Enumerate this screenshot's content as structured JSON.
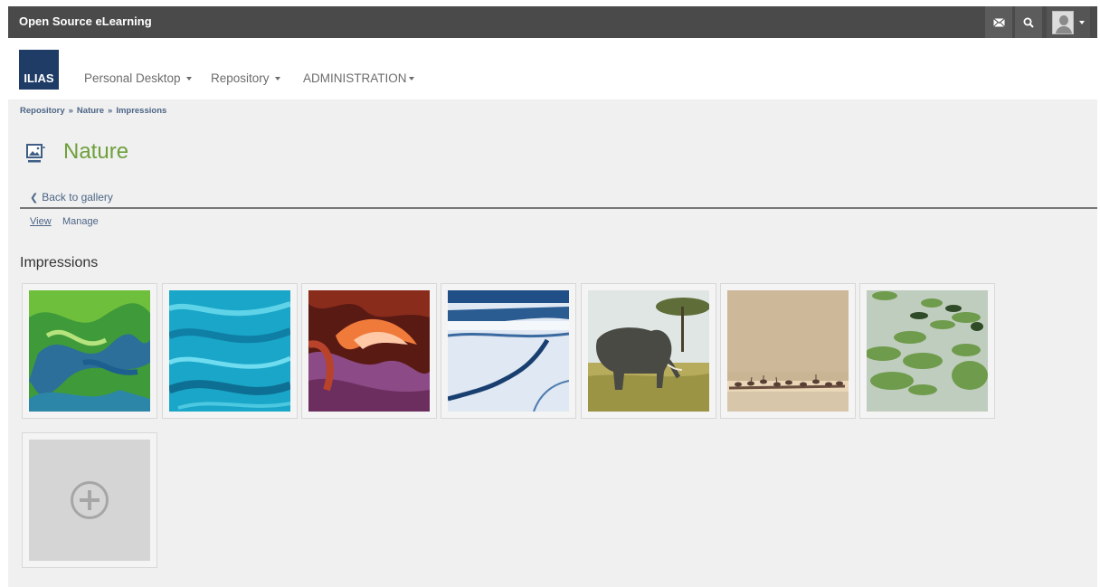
{
  "topbar": {
    "brand": "Open Source eLearning",
    "icons": [
      "mail-icon",
      "search-icon",
      "user-avatar-icon"
    ]
  },
  "header": {
    "logo_text": "ILIAS",
    "nav": {
      "personal_desktop": "Personal Desktop",
      "repository": "Repository",
      "administration": "ADMINISTRATION"
    }
  },
  "breadcrumb": {
    "items": [
      "Repository",
      "Nature",
      "Impressions"
    ],
    "separator": "»"
  },
  "page": {
    "title": "Nature",
    "back_link": "Back to gallery",
    "subtabs": {
      "view": "View",
      "manage": "Manage"
    },
    "section_title": "Impressions"
  },
  "gallery": {
    "images": [
      "aerial-green-water",
      "aerial-turquoise-water",
      "red-sandstone-canyon",
      "ice-floe-crack",
      "elephant-savanna",
      "flamingos-misty-lake",
      "water-lily-pads"
    ],
    "add_icon": "plus-circle-icon"
  },
  "colors": {
    "topbar": "#4a4a4a",
    "logo": "#1f3c66",
    "title": "#6ea03c",
    "link": "#4c6586",
    "background": "#f0f0f0"
  }
}
